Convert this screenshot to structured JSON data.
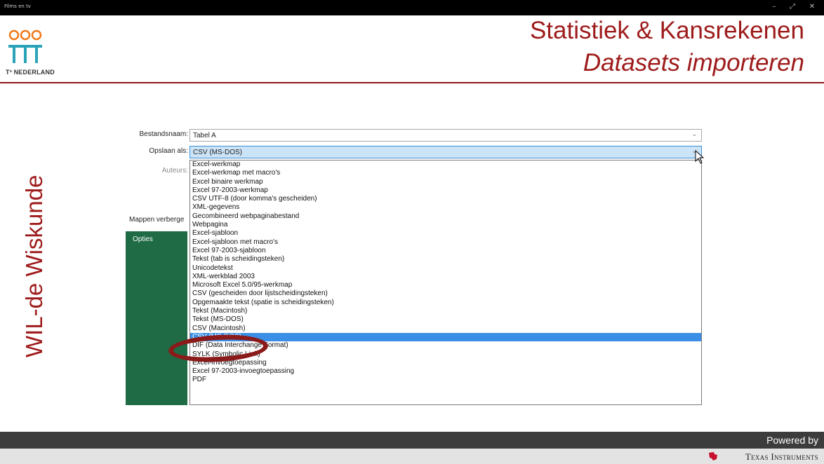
{
  "window": {
    "title": "Films en tv",
    "controls": [
      "–",
      "⤢",
      "✕"
    ]
  },
  "slide": {
    "logo_text": "T³ NEDERLAND",
    "title": "Statistiek & Kansrekenen",
    "subtitle": "Datasets importeren",
    "side_title": "WIL-de Wiskunde"
  },
  "dialog": {
    "filename_label": "Bestandsnaam:",
    "filename_value": "Tabel A",
    "save_as_label": "Opslaan als:",
    "save_as_value": "CSV (MS-DOS)",
    "authors_label": "Auteurs:",
    "hide_folders_label": "Mappen verberge",
    "options_label": "Opties",
    "file_types": [
      "Excel-werkmap",
      "Excel-werkmap met macro's",
      "Excel binaire werkmap",
      "Excel 97-2003-werkmap",
      "CSV UTF-8 (door komma's gescheiden)",
      "XML-gegevens",
      "Gecombineerd webpaginabestand",
      "Webpagina",
      "Excel-sjabloon",
      "Excel-sjabloon met macro's",
      "Excel 97-2003-sjabloon",
      "Tekst (tab is scheidingsteken)",
      "Unicodetekst",
      "XML-werkblad 2003",
      "Microsoft Excel 5.0/95-werkmap",
      "CSV (gescheiden door lijstscheidingsteken)",
      "Opgemaakte tekst (spatie is scheidingsteken)",
      "Tekst (Macintosh)",
      "Tekst (MS-DOS)",
      "CSV (Macintosh)",
      "CSV (MS-DOS)",
      "DIF (Data Interchange Format)",
      "SYLK (Symbolic Link)",
      "Excel-invoegtoepassing",
      "Excel 97-2003-invoegtoepassing",
      "PDF"
    ],
    "selected_index": 20
  },
  "footer": {
    "powered_by": "Powered by",
    "brand": "Texas Instruments"
  },
  "colors": {
    "accent_red": "#9e1b1b",
    "excel_green": "#1e6b45",
    "selection_blue": "#3a8ee6"
  }
}
